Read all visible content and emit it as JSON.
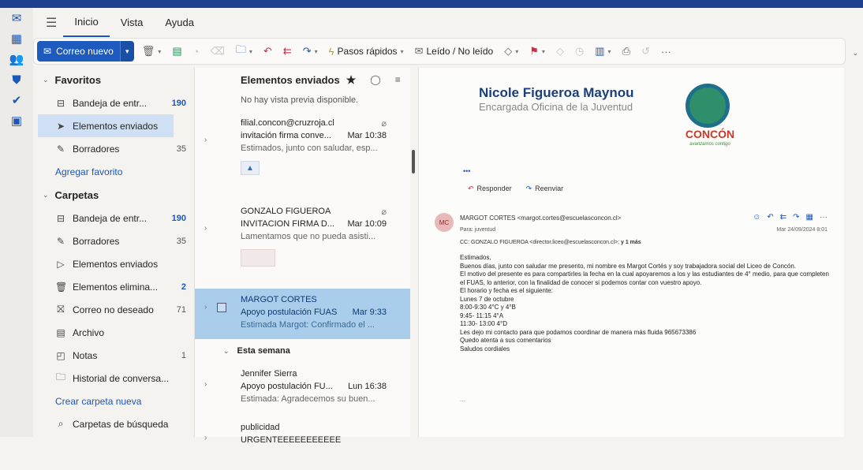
{
  "tabs": [
    "Inicio",
    "Vista",
    "Ayuda"
  ],
  "ribbon": {
    "new_mail": "Correo nuevo",
    "quick_steps": "Pasos rápidos",
    "read_unread": "Leído / No leído",
    "more": "···"
  },
  "folders": {
    "favorites_title": "Favoritos",
    "favorites": [
      {
        "label": "Bandeja de entr...",
        "count": "190",
        "icon": "inbox-icon"
      },
      {
        "label": "Elementos enviados",
        "count": "",
        "icon": "send-icon"
      },
      {
        "label": "Borradores",
        "count": "35",
        "icon": "pencil-icon"
      }
    ],
    "add_favorite": "Agregar favorito",
    "folders_title": "Carpetas",
    "items": [
      {
        "label": "Bandeja de entr...",
        "count": "190",
        "icon": "inbox-icon"
      },
      {
        "label": "Borradores",
        "count": "35",
        "icon": "pencil-icon"
      },
      {
        "label": "Elementos enviados",
        "count": "",
        "icon": "send-icon"
      },
      {
        "label": "Elementos elimina...",
        "count": "2",
        "icon": "trash-icon"
      },
      {
        "label": "Correo no deseado",
        "count": "71",
        "icon": "junk-icon"
      },
      {
        "label": "Archivo",
        "count": "",
        "icon": "archive-icon"
      },
      {
        "label": "Notas",
        "count": "1",
        "icon": "notes-icon"
      },
      {
        "label": "Historial de conversa...",
        "count": "",
        "icon": "folder-icon"
      }
    ],
    "create_folder": "Crear carpeta nueva",
    "search_folders": "Carpetas de búsqueda"
  },
  "list": {
    "title": "Elementos enviados",
    "preview_note": "No hay vista previa disponible.",
    "messages": [
      {
        "sender": "filial.concon@cruzroja.cl",
        "subject": "invitación firma conve...",
        "time": "Mar 10:38",
        "snippet": "Estimados, junto con saludar, esp..."
      },
      {
        "sender": "GONZALO FIGUEROA",
        "subject": "INVITACION FIRMA D...",
        "time": "Mar 10:09",
        "snippet": "Lamentamos que no pueda asisti..."
      },
      {
        "sender": "MARGOT CORTES",
        "subject": "Apoyo postulación FUAS",
        "time": "Mar 9:33",
        "snippet": "Estimada Margot: Confirmado el ..."
      }
    ],
    "week_label": "Esta semana",
    "week_messages": [
      {
        "sender": "Jennifer Sierra",
        "subject": "Apoyo postulación FU...",
        "time": "Lun 16:38",
        "snippet": "Estimada: Agradecemos su buen..."
      },
      {
        "sender": "publicidad",
        "subject": "URGENTEEEEEEEEEEE",
        "time": "",
        "snippet": ""
      }
    ]
  },
  "reading": {
    "sig_name": "Nicole Figueroa Maynou",
    "sig_role": "Encargada Oficina de la Juventud",
    "logo_text": "CONCÓN",
    "logo_sub": "avanzamos contigo",
    "dots": "•••",
    "reply": "Responder",
    "forward": "Reenviar",
    "avatar": "MC",
    "from": "MARGOT CORTES <margot.cortes@escuelasconcon.cl>",
    "to": "Para: juventud",
    "cc_label": "CC:",
    "cc": "GONZALO FIGUEROA <director.liceo@escuelasconcon.cl>;",
    "cc_more": "y 1 más",
    "date": "Mar 24/09/2024 8:01",
    "body": [
      "Estimados,",
      "Buenos días, junto con saludar me presento, mi nombre es Margot Cortés y soy trabajadora social del Liceo de Concón.",
      "El motivo del presente es para compartirles la fecha en la cual apoyaremos a los y las estudiantes de 4° medio, para que completen el FUAS, lo anterior, con la finalidad de conocer si podemos contar con vuestro apoyo.",
      "El horario y fecha es el siguiente:",
      "Lunes 7 de octubre",
      "8:00-9:30 4°C y 4°B",
      "9:45- 11:15 4°A",
      "11:30- 13:00 4°D",
      "Les dejo mi contacto para que podamos coordinar de manera más fluida 965673386",
      "Quedo atenta a sus comentarios",
      "Saludos cordiales"
    ],
    "end": "..."
  },
  "colors": {
    "accent": "#1d5bbf",
    "selected_row": "#a9cdea",
    "selected_folder": "#cfe0f5",
    "brand_top": "#1f3f8f"
  }
}
